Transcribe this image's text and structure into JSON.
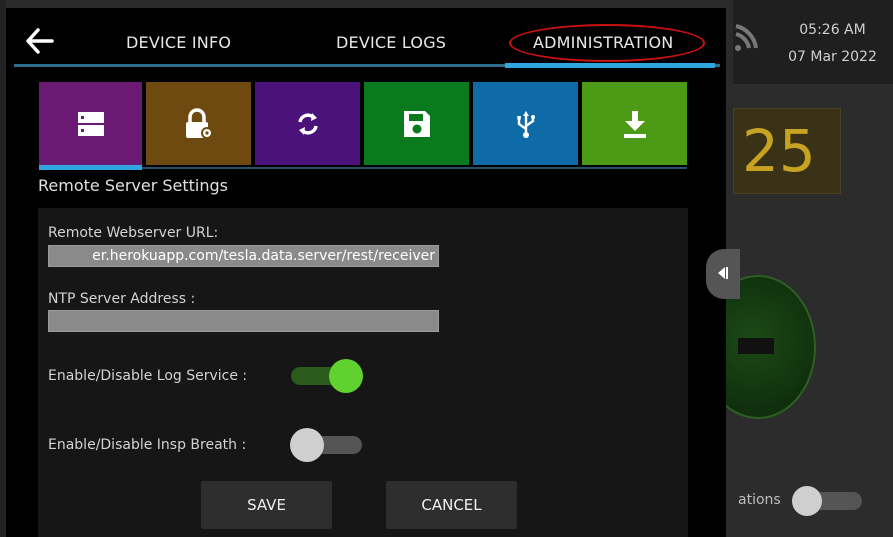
{
  "status": {
    "time": "05:26 AM",
    "date": "07 Mar 2022"
  },
  "background": {
    "big_value": "25",
    "notification_label": "ations"
  },
  "nav": {
    "tabs": [
      {
        "label": "DEVICE INFO"
      },
      {
        "label": "DEVICE LOGS"
      },
      {
        "label": "ADMINISTRATION"
      }
    ],
    "active_tab": "ADMINISTRATION"
  },
  "tiles": [
    {
      "name": "remote-server",
      "icon": "server-icon",
      "color": "#6a1a73",
      "selected": true
    },
    {
      "name": "security",
      "icon": "lock-gear-icon",
      "color": "#6e4a10",
      "selected": false
    },
    {
      "name": "sync",
      "icon": "refresh-icon",
      "color": "#4a127a",
      "selected": false
    },
    {
      "name": "save",
      "icon": "floppy-disk-icon",
      "color": "#0a7a1f",
      "selected": false
    },
    {
      "name": "usb",
      "icon": "usb-icon",
      "color": "#0f6aa8",
      "selected": false
    },
    {
      "name": "download",
      "icon": "download-icon",
      "color": "#4c9a16",
      "selected": false
    }
  ],
  "section_title": "Remote Server Settings",
  "form": {
    "url_label": "Remote Webserver URL:",
    "url_value": "er.herokuapp.com/tesla.data.server/rest/receiver",
    "ntp_label": "NTP Server Address :",
    "ntp_value": "",
    "log_service_label": "Enable/Disable Log Service :",
    "log_service_enabled": true,
    "insp_breath_label": "Enable/Disable Insp Breath :",
    "insp_breath_enabled": false
  },
  "buttons": {
    "save": "SAVE",
    "cancel": "CANCEL"
  },
  "colors": {
    "accent": "#2fa6e0",
    "toggle_on_knob": "#5fd22f",
    "toggle_on_track": "#2a5a1c",
    "toggle_off_knob": "#cfcfcf",
    "toggle_off_track": "#555555",
    "highlight_circle": "#cc1111"
  }
}
